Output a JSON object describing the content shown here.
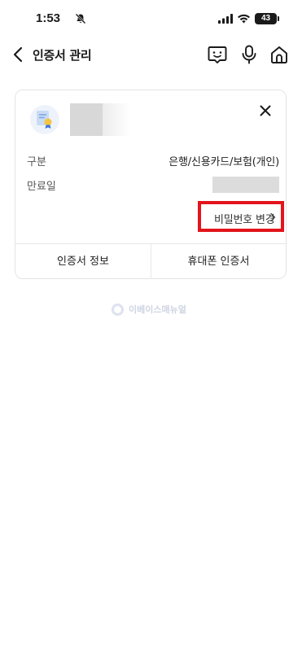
{
  "status_bar": {
    "time": "1:53",
    "battery_level": "43"
  },
  "header": {
    "title": "인증서 관리"
  },
  "certificate_card": {
    "type_label": "구분",
    "type_value": "은행/신용카드/보험(개인)",
    "expiry_label": "만료일",
    "password_change_label": "비밀번호 변경",
    "highlight_color": "#e3141c"
  },
  "footer": {
    "cert_info_label": "인증서 정보",
    "phone_cert_label": "휴대폰 인증서"
  },
  "watermark": {
    "text": "이베이스매뉴얼"
  }
}
